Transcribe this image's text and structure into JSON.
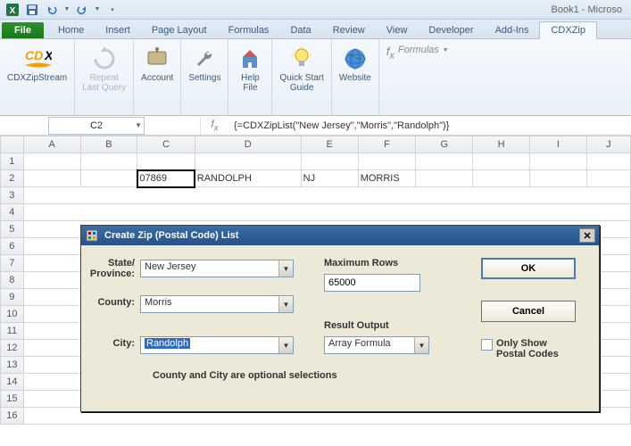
{
  "qat": {
    "title": "Book1 - Microso"
  },
  "tabs": {
    "file": "File",
    "list": [
      "Home",
      "Insert",
      "Page Layout",
      "Formulas",
      "Data",
      "Review",
      "View",
      "Developer",
      "Add-Ins",
      "CDXZip"
    ],
    "activeIndex": 9
  },
  "ribbon": {
    "btn1": "CDXZipStream",
    "btn2a": "Repeat",
    "btn2b": "Last Query",
    "btn3": "Account",
    "btn4": "Settings",
    "btn5a": "Help",
    "btn5b": "File",
    "btn6a": "Quick Start",
    "btn6b": "Guide",
    "btn7": "Website",
    "fxlabel": "Formulas"
  },
  "bar": {
    "namebox": "C2",
    "formula": "{=CDXZipList(\"New Jersey\",\"Morris\",\"Randolph\")}"
  },
  "sheet": {
    "cols": [
      "A",
      "B",
      "C",
      "D",
      "E",
      "F",
      "G",
      "H",
      "I",
      "J"
    ],
    "row2": {
      "C": "07869",
      "D": "RANDOLPH",
      "E": "NJ",
      "F": "MORRIS"
    }
  },
  "dialog": {
    "title": "Create Zip (Postal Code) List",
    "state_lbl1": "State/",
    "state_lbl2": "Province:",
    "state_val": "New Jersey",
    "county_lbl": "County:",
    "county_val": "Morris",
    "city_lbl": "City:",
    "city_val": "Randolph",
    "max_lbl": "Maximum Rows",
    "max_val": "65000",
    "result_lbl": "Result Output",
    "result_val": "Array Formula",
    "ok": "OK",
    "cancel": "Cancel",
    "onlyshow1": "Only Show",
    "onlyshow2": "Postal Codes",
    "note": "County and City are optional selections"
  }
}
